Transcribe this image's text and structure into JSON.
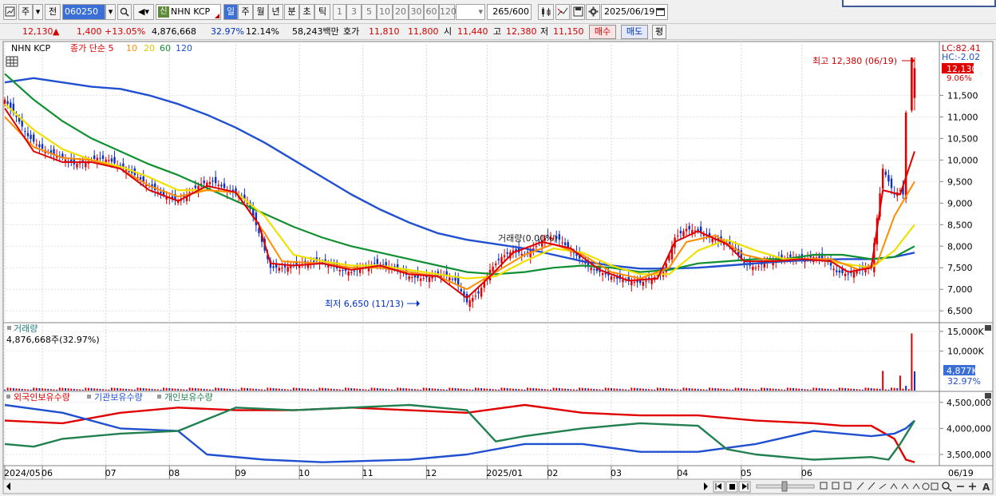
{
  "toolbar": {
    "period_btn": "주",
    "prev_btn": "전",
    "stock_code": "060250",
    "badge": "신",
    "stock_name": "NHN KCP",
    "intervals": [
      "일",
      "주",
      "월",
      "년",
      "분",
      "초",
      "틱"
    ],
    "interval_selected": "일",
    "numbers": [
      "1",
      "3",
      "5",
      "10",
      "20",
      "30",
      "60",
      "120"
    ],
    "count": "265",
    "count_total": "/600",
    "date": "2025/06/19"
  },
  "quote": {
    "price": "12,130",
    "arrow": "▲",
    "change": "1,400",
    "change_pct": "+13.05%",
    "volume": "4,876,668",
    "volume_ratio": "32.97%",
    "turnover": "12.14%",
    "amount": "58,243백만",
    "ask_label": "호가",
    "ask1": "11,810",
    "ask2": "11,800",
    "open_label": "시",
    "open": "11,440",
    "high_label": "고",
    "high": "12,380",
    "low_label": "저",
    "low": "11,150",
    "buy_btn": "매수",
    "sell_btn": "매도",
    "eval_btn": "평"
  },
  "chart_data": {
    "type": "line",
    "stock": "NHN KCP",
    "price_legend": [
      "종가 단순 5",
      "10",
      "20",
      "60",
      "120"
    ],
    "price_legend_colors": [
      "#e00000",
      "#ff8c00",
      "#f0e000",
      "#109030",
      "#2050d0"
    ],
    "y_ticks": [
      "12,130",
      "11,500",
      "11,000",
      "10,500",
      "10,000",
      "9,500",
      "9,000",
      "8,500",
      "8,000",
      "7,500",
      "7,000",
      "6,500"
    ],
    "ylim": [
      6300,
      12600
    ],
    "lc": "LC:82.41",
    "hc": "HC:-2.02",
    "current_label": "12,130",
    "current_pct": "9.06%",
    "high_annot": "최고 12,380 (06/19)",
    "low_annot": "최저 6,650 (11/13)",
    "ghost_label": "거래량(0.00%)",
    "x_ticks": [
      "2024/05",
      "06",
      "07",
      "08",
      "09",
      "10",
      "11",
      "12",
      "2025/01",
      "02",
      "03",
      "04",
      "05",
      "06"
    ],
    "x_end": "06/19",
    "close": [
      [
        0,
        11400
      ],
      [
        4,
        11000
      ],
      [
        8,
        10550
      ],
      [
        12,
        10300
      ],
      [
        16,
        10150
      ],
      [
        20,
        10050
      ],
      [
        24,
        9900
      ],
      [
        28,
        9950
      ],
      [
        32,
        10050
      ],
      [
        36,
        10000
      ],
      [
        40,
        9850
      ],
      [
        44,
        9700
      ],
      [
        48,
        9500
      ],
      [
        52,
        9300
      ],
      [
        56,
        9150
      ],
      [
        60,
        9050
      ],
      [
        64,
        9250
      ],
      [
        68,
        9450
      ],
      [
        72,
        9500
      ],
      [
        76,
        9350
      ],
      [
        80,
        9200
      ],
      [
        84,
        9050
      ],
      [
        88,
        8300
      ],
      [
        92,
        7500
      ],
      [
        96,
        7500
      ],
      [
        100,
        7550
      ],
      [
        104,
        7600
      ],
      [
        108,
        7650
      ],
      [
        112,
        7600
      ],
      [
        116,
        7450
      ],
      [
        120,
        7400
      ],
      [
        124,
        7500
      ],
      [
        128,
        7600
      ],
      [
        132,
        7550
      ],
      [
        136,
        7450
      ],
      [
        140,
        7300
      ],
      [
        144,
        7250
      ],
      [
        148,
        7300
      ],
      [
        152,
        7350
      ],
      [
        156,
        7200
      ],
      [
        160,
        6700
      ],
      [
        164,
        6900
      ],
      [
        168,
        7450
      ],
      [
        172,
        7750
      ],
      [
        176,
        7900
      ],
      [
        180,
        7800
      ],
      [
        184,
        8000
      ],
      [
        188,
        8250
      ],
      [
        192,
        8150
      ],
      [
        196,
        7900
      ],
      [
        200,
        7650
      ],
      [
        204,
        7450
      ],
      [
        208,
        7350
      ],
      [
        212,
        7250
      ],
      [
        216,
        7200
      ],
      [
        220,
        7150
      ],
      [
        224,
        7250
      ],
      [
        228,
        7400
      ],
      [
        232,
        8200
      ],
      [
        236,
        8400
      ],
      [
        240,
        8350
      ],
      [
        244,
        8200
      ],
      [
        248,
        8100
      ],
      [
        252,
        8000
      ],
      [
        256,
        7600
      ],
      [
        260,
        7500
      ],
      [
        264,
        7650
      ],
      [
        268,
        7700
      ],
      [
        272,
        7750
      ],
      [
        276,
        7700
      ],
      [
        280,
        7750
      ],
      [
        284,
        7700
      ],
      [
        288,
        7400
      ],
      [
        292,
        7350
      ],
      [
        296,
        7450
      ],
      [
        300,
        7500
      ],
      [
        304,
        9800
      ],
      [
        308,
        9200
      ],
      [
        310,
        9300
      ],
      [
        312,
        9100
      ],
      [
        315,
        12130
      ]
    ],
    "ma5": [
      [
        0,
        11200
      ],
      [
        10,
        10200
      ],
      [
        20,
        9950
      ],
      [
        30,
        9950
      ],
      [
        40,
        9800
      ],
      [
        50,
        9300
      ],
      [
        60,
        9050
      ],
      [
        70,
        9400
      ],
      [
        80,
        9250
      ],
      [
        88,
        8500
      ],
      [
        92,
        7600
      ],
      [
        100,
        7550
      ],
      [
        110,
        7600
      ],
      [
        120,
        7450
      ],
      [
        130,
        7550
      ],
      [
        140,
        7350
      ],
      [
        150,
        7300
      ],
      [
        160,
        6800
      ],
      [
        168,
        7300
      ],
      [
        176,
        7850
      ],
      [
        186,
        8100
      ],
      [
        196,
        7950
      ],
      [
        206,
        7450
      ],
      [
        216,
        7200
      ],
      [
        226,
        7250
      ],
      [
        232,
        8100
      ],
      [
        240,
        8350
      ],
      [
        250,
        8050
      ],
      [
        256,
        7650
      ],
      [
        266,
        7650
      ],
      [
        276,
        7700
      ],
      [
        286,
        7650
      ],
      [
        292,
        7400
      ],
      [
        300,
        7500
      ],
      [
        304,
        9300
      ],
      [
        310,
        9200
      ],
      [
        315,
        10200
      ]
    ],
    "ma10": [
      [
        0,
        11000
      ],
      [
        10,
        10300
      ],
      [
        20,
        10050
      ],
      [
        30,
        10000
      ],
      [
        40,
        9800
      ],
      [
        50,
        9400
      ],
      [
        60,
        9150
      ],
      [
        70,
        9300
      ],
      [
        80,
        9250
      ],
      [
        90,
        8300
      ],
      [
        96,
        7650
      ],
      [
        110,
        7600
      ],
      [
        120,
        7500
      ],
      [
        130,
        7500
      ],
      [
        140,
        7400
      ],
      [
        150,
        7300
      ],
      [
        160,
        7000
      ],
      [
        170,
        7400
      ],
      [
        180,
        7800
      ],
      [
        190,
        8050
      ],
      [
        200,
        7800
      ],
      [
        210,
        7400
      ],
      [
        220,
        7250
      ],
      [
        230,
        7500
      ],
      [
        236,
        8100
      ],
      [
        246,
        8250
      ],
      [
        256,
        7800
      ],
      [
        266,
        7650
      ],
      [
        276,
        7700
      ],
      [
        286,
        7700
      ],
      [
        296,
        7450
      ],
      [
        302,
        7600
      ],
      [
        308,
        8700
      ],
      [
        315,
        9500
      ]
    ],
    "ma20": [
      [
        0,
        11300
      ],
      [
        10,
        10700
      ],
      [
        20,
        10250
      ],
      [
        30,
        10000
      ],
      [
        40,
        9850
      ],
      [
        50,
        9600
      ],
      [
        60,
        9300
      ],
      [
        70,
        9300
      ],
      [
        80,
        9250
      ],
      [
        90,
        8700
      ],
      [
        100,
        7800
      ],
      [
        110,
        7650
      ],
      [
        120,
        7550
      ],
      [
        130,
        7550
      ],
      [
        140,
        7450
      ],
      [
        150,
        7350
      ],
      [
        160,
        7250
      ],
      [
        170,
        7300
      ],
      [
        180,
        7650
      ],
      [
        190,
        7950
      ],
      [
        200,
        7850
      ],
      [
        210,
        7550
      ],
      [
        220,
        7350
      ],
      [
        230,
        7350
      ],
      [
        240,
        7900
      ],
      [
        250,
        8150
      ],
      [
        260,
        7900
      ],
      [
        270,
        7700
      ],
      [
        280,
        7700
      ],
      [
        290,
        7600
      ],
      [
        300,
        7500
      ],
      [
        308,
        7900
      ],
      [
        315,
        8500
      ]
    ],
    "ma60": [
      [
        0,
        12000
      ],
      [
        10,
        11400
      ],
      [
        20,
        10900
      ],
      [
        30,
        10500
      ],
      [
        40,
        10200
      ],
      [
        50,
        9900
      ],
      [
        60,
        9650
      ],
      [
        70,
        9350
      ],
      [
        80,
        9050
      ],
      [
        90,
        8750
      ],
      [
        100,
        8450
      ],
      [
        110,
        8200
      ],
      [
        120,
        8000
      ],
      [
        130,
        7850
      ],
      [
        140,
        7700
      ],
      [
        150,
        7550
      ],
      [
        160,
        7400
      ],
      [
        170,
        7350
      ],
      [
        180,
        7400
      ],
      [
        190,
        7500
      ],
      [
        200,
        7550
      ],
      [
        210,
        7500
      ],
      [
        220,
        7400
      ],
      [
        230,
        7450
      ],
      [
        240,
        7600
      ],
      [
        250,
        7650
      ],
      [
        260,
        7700
      ],
      [
        270,
        7700
      ],
      [
        280,
        7800
      ],
      [
        290,
        7800
      ],
      [
        300,
        7700
      ],
      [
        308,
        7750
      ],
      [
        315,
        8000
      ]
    ],
    "ma120": [
      [
        0,
        11800
      ],
      [
        10,
        11900
      ],
      [
        20,
        11800
      ],
      [
        30,
        11700
      ],
      [
        40,
        11650
      ],
      [
        50,
        11500
      ],
      [
        60,
        11300
      ],
      [
        70,
        11050
      ],
      [
        80,
        10750
      ],
      [
        90,
        10400
      ],
      [
        100,
        10000
      ],
      [
        110,
        9600
      ],
      [
        120,
        9200
      ],
      [
        130,
        8850
      ],
      [
        140,
        8550
      ],
      [
        150,
        8300
      ],
      [
        160,
        8150
      ],
      [
        170,
        8050
      ],
      [
        180,
        7950
      ],
      [
        190,
        7800
      ],
      [
        200,
        7650
      ],
      [
        210,
        7550
      ],
      [
        220,
        7480
      ],
      [
        230,
        7480
      ],
      [
        240,
        7500
      ],
      [
        250,
        7550
      ],
      [
        260,
        7600
      ],
      [
        270,
        7650
      ],
      [
        280,
        7680
      ],
      [
        290,
        7700
      ],
      [
        300,
        7700
      ],
      [
        308,
        7750
      ],
      [
        315,
        7850
      ]
    ],
    "volume_title": "거래량",
    "volume_text": "4,876,668주(32.97%)",
    "volume_ticks": [
      "15,000K",
      "10,000K"
    ],
    "volume_current": "4,877K",
    "volume_pct": "32.97%",
    "volume_ylim": [
      0,
      16000
    ],
    "volume_spikes": [
      [
        304,
        5000
      ],
      [
        310,
        3800
      ],
      [
        312,
        1200
      ],
      [
        314,
        14500
      ],
      [
        315,
        4877
      ]
    ],
    "holdings_legend": [
      "외국인보유수량",
      "기관보유수량",
      "개인보유수량"
    ],
    "holdings_colors": [
      "#e00000",
      "#2050d0",
      "#208050"
    ],
    "holdings_ticks": [
      "4,500,000",
      "4,000,000",
      "3,500,000"
    ],
    "holdings_ylim": [
      3300000,
      4650000
    ],
    "foreign": [
      [
        0,
        4150000
      ],
      [
        20,
        4100000
      ],
      [
        40,
        4300000
      ],
      [
        60,
        4400000
      ],
      [
        80,
        4350000
      ],
      [
        100,
        4350000
      ],
      [
        120,
        4400000
      ],
      [
        140,
        4350000
      ],
      [
        160,
        4300000
      ],
      [
        180,
        4450000
      ],
      [
        200,
        4300000
      ],
      [
        220,
        4250000
      ],
      [
        240,
        4250000
      ],
      [
        260,
        4150000
      ],
      [
        280,
        4100000
      ],
      [
        290,
        4050000
      ],
      [
        300,
        4050000
      ],
      [
        308,
        3800000
      ],
      [
        312,
        3400000
      ],
      [
        315,
        3350000
      ]
    ],
    "institution": [
      [
        0,
        4450000
      ],
      [
        20,
        4300000
      ],
      [
        40,
        4000000
      ],
      [
        60,
        3950000
      ],
      [
        70,
        3500000
      ],
      [
        90,
        3400000
      ],
      [
        110,
        3350000
      ],
      [
        140,
        3400000
      ],
      [
        160,
        3500000
      ],
      [
        180,
        3700000
      ],
      [
        200,
        3700000
      ],
      [
        220,
        3550000
      ],
      [
        240,
        3550000
      ],
      [
        260,
        3700000
      ],
      [
        280,
        3950000
      ],
      [
        300,
        3850000
      ],
      [
        308,
        3900000
      ],
      [
        312,
        4000000
      ],
      [
        315,
        4150000
      ]
    ],
    "individual": [
      [
        0,
        3700000
      ],
      [
        10,
        3650000
      ],
      [
        20,
        3800000
      ],
      [
        40,
        3900000
      ],
      [
        60,
        3950000
      ],
      [
        80,
        4400000
      ],
      [
        100,
        4350000
      ],
      [
        120,
        4400000
      ],
      [
        140,
        4450000
      ],
      [
        160,
        4350000
      ],
      [
        170,
        3750000
      ],
      [
        180,
        3850000
      ],
      [
        200,
        4000000
      ],
      [
        220,
        4100000
      ],
      [
        240,
        4050000
      ],
      [
        250,
        3600000
      ],
      [
        260,
        3500000
      ],
      [
        280,
        3400000
      ],
      [
        300,
        3450000
      ],
      [
        306,
        3400000
      ],
      [
        310,
        3700000
      ],
      [
        315,
        4150000
      ]
    ]
  }
}
